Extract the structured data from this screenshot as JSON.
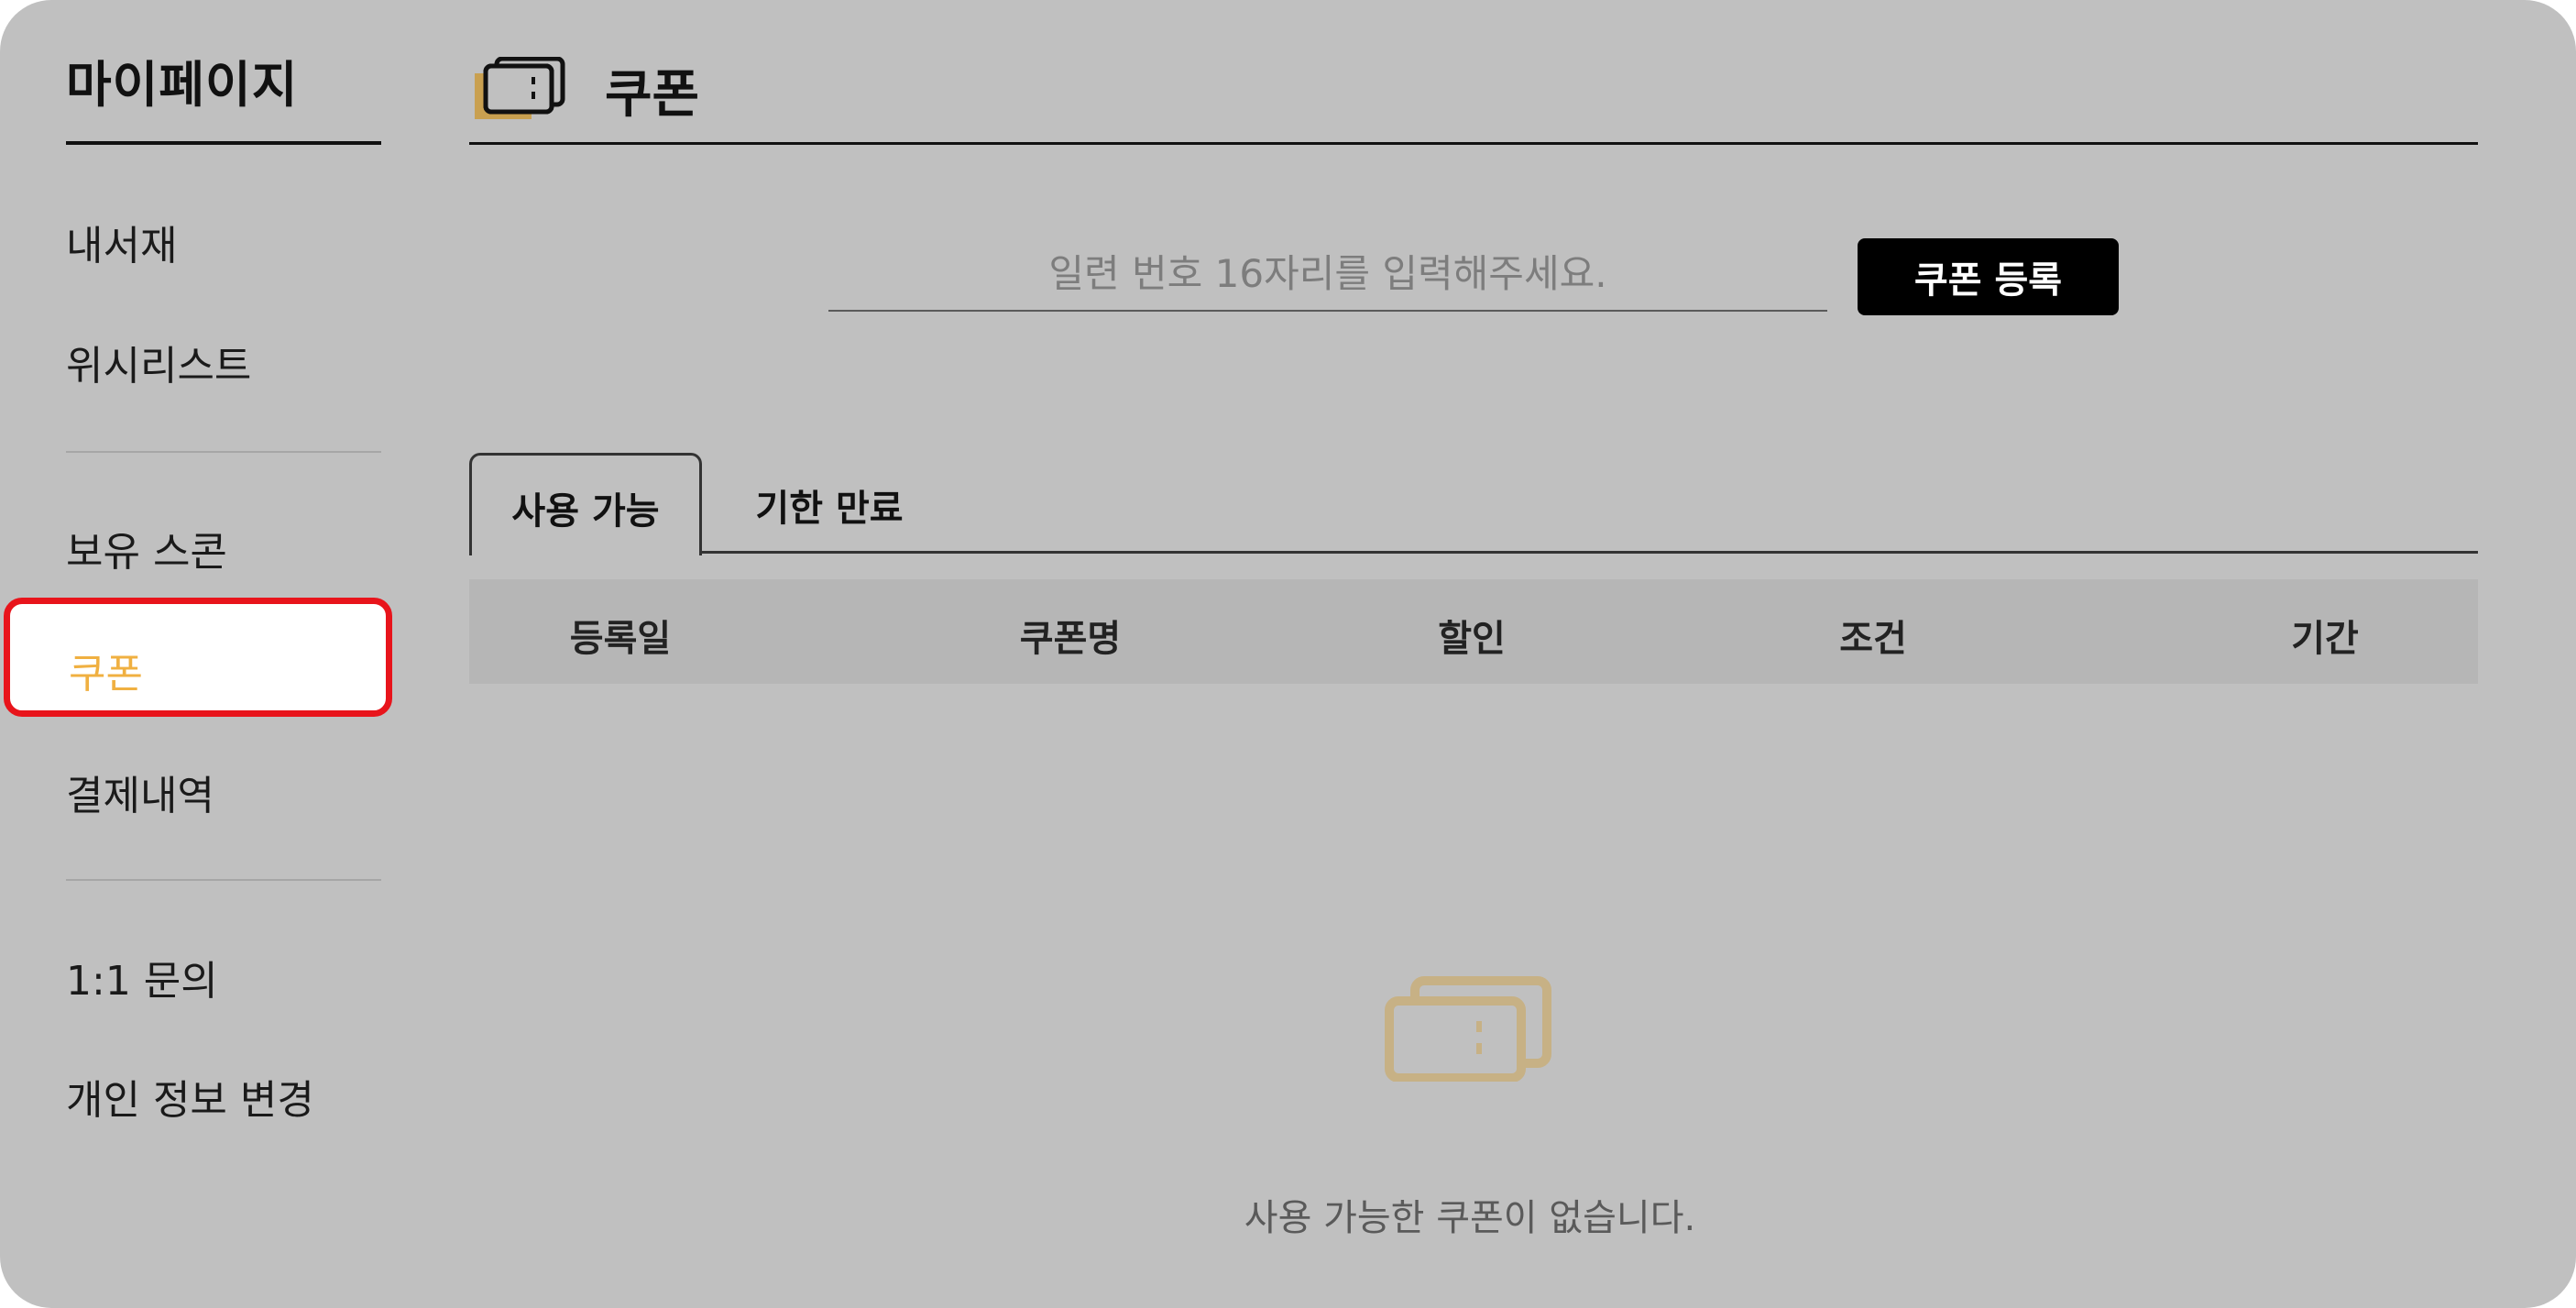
{
  "sidebar": {
    "title": "마이페이지",
    "items": [
      {
        "label": "내서재"
      },
      {
        "label": "위시리스트"
      },
      {
        "label": "보유 스콘"
      },
      {
        "label": "쿠폰"
      },
      {
        "label": "결제내역"
      },
      {
        "label": "1:1 문의"
      },
      {
        "label": "개인 정보 변경"
      }
    ],
    "active_index": 3
  },
  "header": {
    "title": "쿠폰",
    "icon": "coupon-icon"
  },
  "coupon_form": {
    "placeholder": "일련 번호 16자리를 입력해주세요.",
    "value": "",
    "button_label": "쿠폰 등록"
  },
  "tabs": [
    {
      "label": "사용 가능",
      "active": true
    },
    {
      "label": "기한 만료",
      "active": false
    }
  ],
  "table": {
    "columns": [
      "등록일",
      "쿠폰명",
      "할인",
      "조건",
      "기간"
    ],
    "rows": []
  },
  "empty_state": {
    "icon": "coupon-icon",
    "message": "사용 가능한 쿠폰이 없습니다."
  },
  "colors": {
    "background": "#c0c0c0",
    "accent_gold": "#c9a050",
    "active_text": "#f0b041",
    "highlight_border": "#e8141b",
    "button_bg": "#000000"
  }
}
